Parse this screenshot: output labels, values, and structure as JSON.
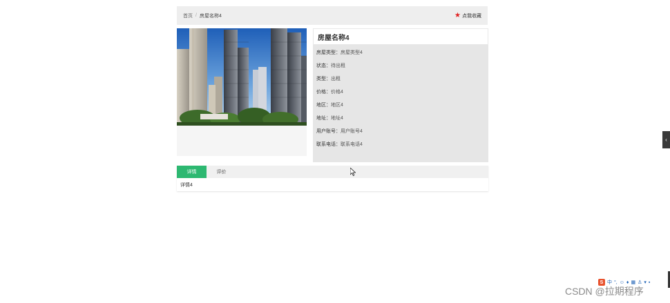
{
  "breadcrumb": {
    "home": "首页",
    "separator": "/",
    "current": "房屋名称4"
  },
  "favorite": {
    "label": "点我收藏",
    "icon": "star-icon",
    "color": "#e02020"
  },
  "house": {
    "title": "房屋名称4",
    "fields": [
      {
        "key": "房屋类型：",
        "value": "房屋类型4"
      },
      {
        "key": "状态：",
        "value": "待出租"
      },
      {
        "key": "类型：",
        "value": "出租"
      },
      {
        "key": "价格：",
        "value": "价格4"
      },
      {
        "key": "地区：",
        "value": "地区4"
      },
      {
        "key": "地址：",
        "value": "地址4"
      },
      {
        "key": "用户账号：",
        "value": "用户账号4"
      },
      {
        "key": "联系电话：",
        "value": "联系电话4"
      }
    ]
  },
  "tabs": [
    {
      "label": "详情",
      "active": true
    },
    {
      "label": "评价",
      "active": false
    }
  ],
  "tab_content": "详情4",
  "accent_color": "#2db871",
  "ime_toolbar": {
    "logo": "S",
    "label": "中"
  },
  "watermark": "CSDN @拉期程序"
}
